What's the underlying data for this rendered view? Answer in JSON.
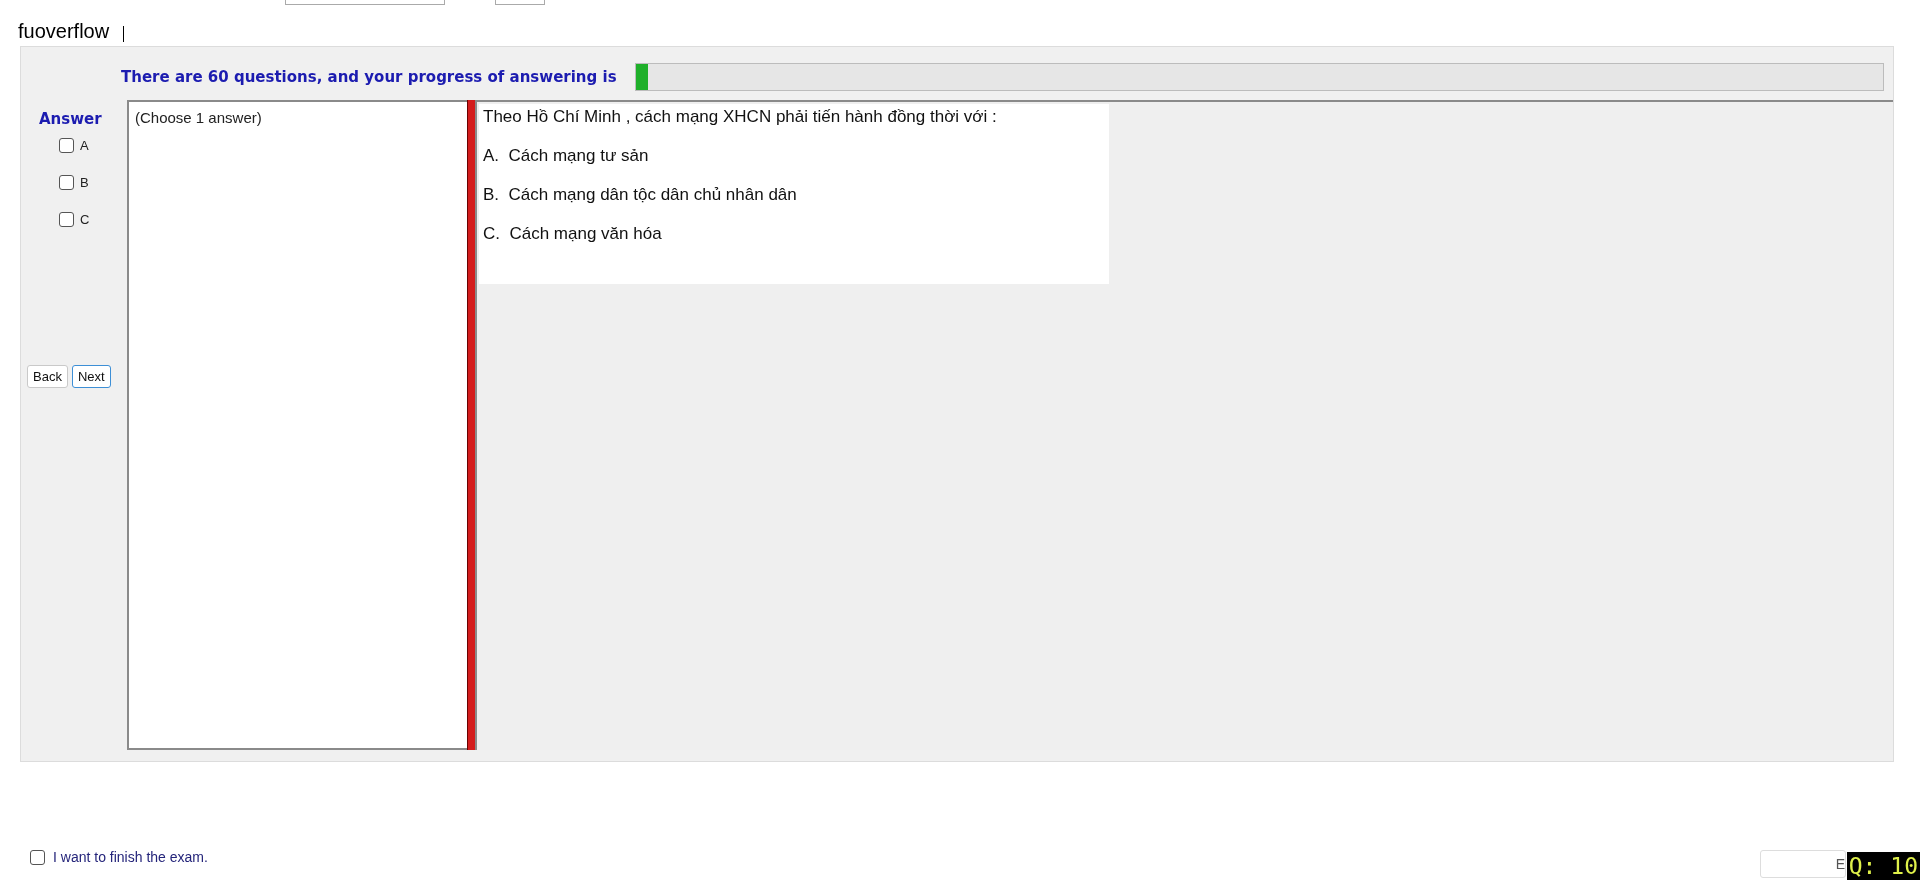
{
  "header": {
    "title": "fuoverflow"
  },
  "progress": {
    "label": "There are 60 questions, and your progress of answering is",
    "level": 0.01
  },
  "answer": {
    "label": "Answer",
    "options": [
      {
        "label": "A",
        "checked": false
      },
      {
        "label": "B",
        "checked": false
      },
      {
        "label": "C",
        "checked": false
      }
    ]
  },
  "navigation": {
    "buttons": [
      "Back",
      "Next"
    ]
  },
  "answer_box": {
    "hint": "(Choose 1 answer)"
  },
  "question": {
    "text": "Theo Hồ Chí Minh , cách mạng XHCN phải tiến hành đồng thời với :",
    "choices": [
      "A.  Cách mạng tư sản",
      "B.  Cách mạng dân tộc dân chủ nhân dân",
      "C.  Cách mạng văn hóa"
    ]
  },
  "finish": {
    "label": "I want to finish the exam.",
    "checked": false
  },
  "bottom_button": {
    "label": "E"
  },
  "question_counter": "Q: 10"
}
